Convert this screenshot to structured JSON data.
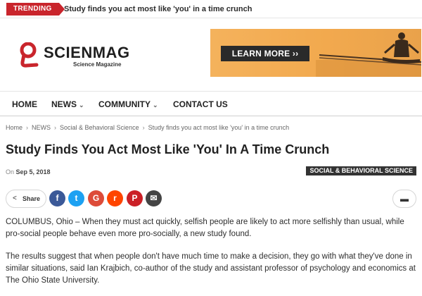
{
  "trending": {
    "badge": "TRENDING",
    "headline": "Study finds you act most like 'you' in a time crunch"
  },
  "logo": {
    "name": "SCIENMAG",
    "tagline": "Science Magazine"
  },
  "ad": {
    "cta": "LEARN MORE ››"
  },
  "nav": {
    "items": [
      {
        "label": "HOME"
      },
      {
        "label": "NEWS"
      },
      {
        "label": "COMMUNITY"
      },
      {
        "label": "CONTACT US"
      }
    ]
  },
  "breadcrumb": [
    "Home",
    "NEWS",
    "Social & Behavioral Science",
    "Study finds you act most like 'you' in a time crunch"
  ],
  "article": {
    "title": "Study Finds You Act Most Like 'You' In A Time Crunch",
    "date_prefix": "On",
    "date": "Sep 5, 2018",
    "category": "SOCIAL & BEHAVIORAL SCIENCE",
    "share_label": "Share",
    "paragraphs": [
      "COLUMBUS, Ohio – When they must act quickly, selfish people are likely to act more selfishly than usual, while pro-social people behave even more pro-socially, a new study found.",
      "The results suggest that when people don't have much time to make a decision, they go with what they've done in similar situations, said Ian Krajbich, co-author of the study and assistant professor of psychology and economics at The Ohio State University."
    ]
  },
  "social": [
    {
      "name": "facebook-icon",
      "glyph": "f",
      "color": "#3b5998"
    },
    {
      "name": "twitter-icon",
      "glyph": "t",
      "color": "#1da1f2"
    },
    {
      "name": "google-plus-icon",
      "glyph": "G",
      "color": "#dd4b39"
    },
    {
      "name": "reddit-icon",
      "glyph": "r",
      "color": "#ff4500"
    },
    {
      "name": "pinterest-icon",
      "glyph": "P",
      "color": "#cb2027"
    },
    {
      "name": "email-icon",
      "glyph": "✉",
      "color": "#444444"
    }
  ],
  "colors": {
    "accent": "#c9252c",
    "ad_background": "#f2a94e"
  }
}
